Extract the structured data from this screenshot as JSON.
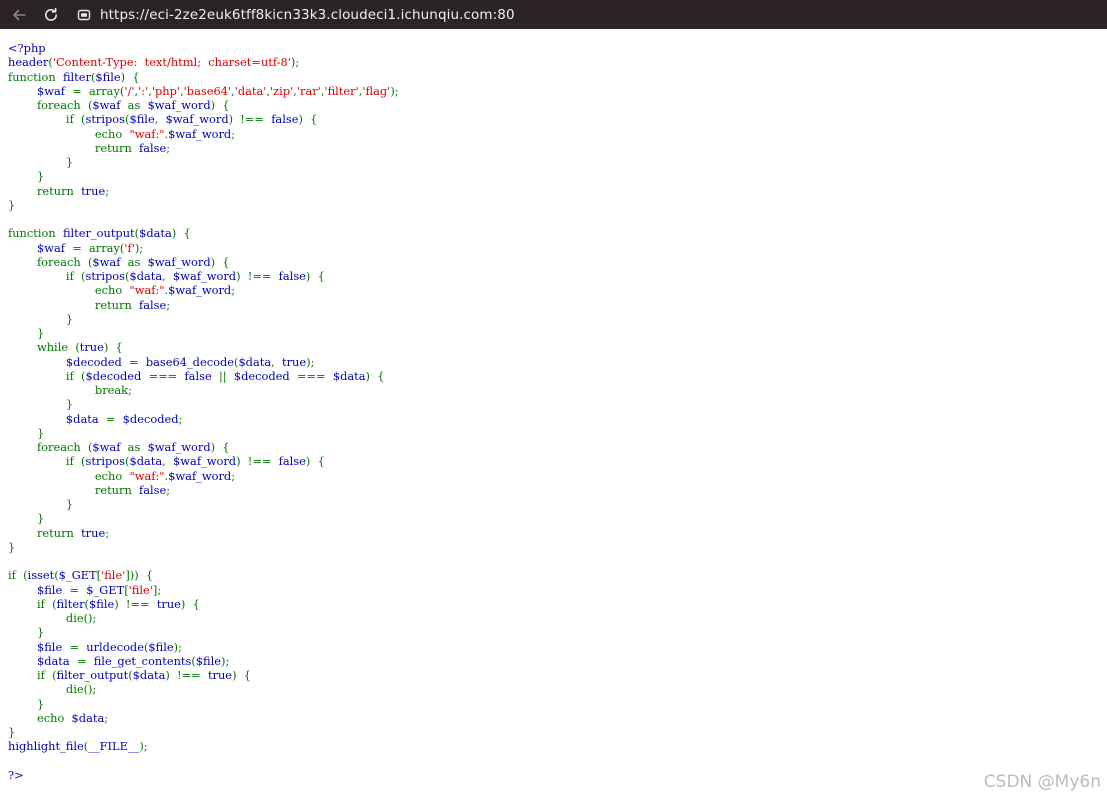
{
  "browser": {
    "url": "https://eci-2ze2euk6tff8kicn33k3.cloudeci1.ichunqiu.com:80",
    "icons": [
      "back-arrow-icon",
      "reload-icon",
      "site-info-icon"
    ]
  },
  "colors": {
    "default": "#0000BB",
    "keyword": "#007700",
    "string": "#DD0000",
    "topbar": "#2b2326"
  },
  "code_lines": [
    [
      [
        "d",
        "<?php"
      ]
    ],
    [
      [
        "d",
        "header"
      ],
      [
        "k",
        "("
      ],
      [
        "s",
        "'Content-Type:  text/html;  charset=utf-8'"
      ],
      [
        "k",
        ");"
      ]
    ],
    [
      [
        "k",
        "function  "
      ],
      [
        "d",
        "filter"
      ],
      [
        "k",
        "("
      ],
      [
        "d",
        "$file"
      ],
      [
        "k",
        ")  {"
      ]
    ],
    [
      [
        "d",
        "        $waf  "
      ],
      [
        "k",
        "=  array("
      ],
      [
        "s",
        "'/'"
      ],
      [
        "k",
        ","
      ],
      [
        "s",
        "':'"
      ],
      [
        "k",
        ","
      ],
      [
        "s",
        "'php'"
      ],
      [
        "k",
        ","
      ],
      [
        "s",
        "'base64'"
      ],
      [
        "k",
        ","
      ],
      [
        "s",
        "'data'"
      ],
      [
        "k",
        ","
      ],
      [
        "s",
        "'zip'"
      ],
      [
        "k",
        ","
      ],
      [
        "s",
        "'rar'"
      ],
      [
        "k",
        ","
      ],
      [
        "s",
        "'filter'"
      ],
      [
        "k",
        ","
      ],
      [
        "s",
        "'flag'"
      ],
      [
        "k",
        ");"
      ]
    ],
    [
      [
        "k",
        "        foreach  ("
      ],
      [
        "d",
        "$waf  "
      ],
      [
        "k",
        "as  "
      ],
      [
        "d",
        "$waf_word"
      ],
      [
        "k",
        ")  {"
      ]
    ],
    [
      [
        "k",
        "                if  ("
      ],
      [
        "d",
        "stripos"
      ],
      [
        "k",
        "("
      ],
      [
        "d",
        "$file"
      ],
      [
        "k",
        ",  "
      ],
      [
        "d",
        "$waf_word"
      ],
      [
        "k",
        ")  !==  "
      ],
      [
        "d",
        "false"
      ],
      [
        "k",
        ")  {"
      ]
    ],
    [
      [
        "k",
        "                        echo  "
      ],
      [
        "s",
        "\"waf:\""
      ],
      [
        "k",
        "."
      ],
      [
        "d",
        "$waf_word"
      ],
      [
        "k",
        ";"
      ]
    ],
    [
      [
        "k",
        "                        return  "
      ],
      [
        "d",
        "false"
      ],
      [
        "k",
        ";"
      ]
    ],
    [
      [
        "k",
        "                }"
      ]
    ],
    [
      [
        "k",
        "        }"
      ]
    ],
    [
      [
        "k",
        "        return  "
      ],
      [
        "d",
        "true"
      ],
      [
        "k",
        ";"
      ]
    ],
    [
      [
        "k",
        "}"
      ]
    ],
    [],
    [
      [
        "k",
        "function  "
      ],
      [
        "d",
        "filter_output"
      ],
      [
        "k",
        "("
      ],
      [
        "d",
        "$data"
      ],
      [
        "k",
        ")  {"
      ]
    ],
    [
      [
        "d",
        "        $waf  "
      ],
      [
        "k",
        "=  array("
      ],
      [
        "s",
        "'f'"
      ],
      [
        "k",
        ");"
      ]
    ],
    [
      [
        "k",
        "        foreach  ("
      ],
      [
        "d",
        "$waf  "
      ],
      [
        "k",
        "as  "
      ],
      [
        "d",
        "$waf_word"
      ],
      [
        "k",
        ")  {"
      ]
    ],
    [
      [
        "k",
        "                if  ("
      ],
      [
        "d",
        "stripos"
      ],
      [
        "k",
        "("
      ],
      [
        "d",
        "$data"
      ],
      [
        "k",
        ",  "
      ],
      [
        "d",
        "$waf_word"
      ],
      [
        "k",
        ")  !==  "
      ],
      [
        "d",
        "false"
      ],
      [
        "k",
        ")  {"
      ]
    ],
    [
      [
        "k",
        "                        echo  "
      ],
      [
        "s",
        "\"waf:\""
      ],
      [
        "k",
        "."
      ],
      [
        "d",
        "$waf_word"
      ],
      [
        "k",
        ";"
      ]
    ],
    [
      [
        "k",
        "                        return  "
      ],
      [
        "d",
        "false"
      ],
      [
        "k",
        ";"
      ]
    ],
    [
      [
        "k",
        "                }"
      ]
    ],
    [
      [
        "k",
        "        }"
      ]
    ],
    [
      [
        "k",
        "        while  ("
      ],
      [
        "d",
        "true"
      ],
      [
        "k",
        ")  {"
      ]
    ],
    [
      [
        "d",
        "                $decoded  "
      ],
      [
        "k",
        "=  "
      ],
      [
        "d",
        "base64_decode"
      ],
      [
        "k",
        "("
      ],
      [
        "d",
        "$data"
      ],
      [
        "k",
        ",  "
      ],
      [
        "d",
        "true"
      ],
      [
        "k",
        ");"
      ]
    ],
    [
      [
        "k",
        "                if  ("
      ],
      [
        "d",
        "$decoded  "
      ],
      [
        "k",
        "===  "
      ],
      [
        "d",
        "false  "
      ],
      [
        "k",
        "||  "
      ],
      [
        "d",
        "$decoded  "
      ],
      [
        "k",
        "===  "
      ],
      [
        "d",
        "$data"
      ],
      [
        "k",
        ")  {"
      ]
    ],
    [
      [
        "k",
        "                        break;"
      ]
    ],
    [
      [
        "k",
        "                }"
      ]
    ],
    [
      [
        "d",
        "                $data  "
      ],
      [
        "k",
        "=  "
      ],
      [
        "d",
        "$decoded"
      ],
      [
        "k",
        ";"
      ]
    ],
    [
      [
        "k",
        "        }"
      ]
    ],
    [
      [
        "k",
        "        foreach  ("
      ],
      [
        "d",
        "$waf  "
      ],
      [
        "k",
        "as  "
      ],
      [
        "d",
        "$waf_word"
      ],
      [
        "k",
        ")  {"
      ]
    ],
    [
      [
        "k",
        "                if  ("
      ],
      [
        "d",
        "stripos"
      ],
      [
        "k",
        "("
      ],
      [
        "d",
        "$data"
      ],
      [
        "k",
        ",  "
      ],
      [
        "d",
        "$waf_word"
      ],
      [
        "k",
        ")  !==  "
      ],
      [
        "d",
        "false"
      ],
      [
        "k",
        ")  {"
      ]
    ],
    [
      [
        "k",
        "                        echo  "
      ],
      [
        "s",
        "\"waf:\""
      ],
      [
        "k",
        "."
      ],
      [
        "d",
        "$waf_word"
      ],
      [
        "k",
        ";"
      ]
    ],
    [
      [
        "k",
        "                        return  "
      ],
      [
        "d",
        "false"
      ],
      [
        "k",
        ";"
      ]
    ],
    [
      [
        "k",
        "                }"
      ]
    ],
    [
      [
        "k",
        "        }"
      ]
    ],
    [
      [
        "k",
        "        return  "
      ],
      [
        "d",
        "true"
      ],
      [
        "k",
        ";"
      ]
    ],
    [
      [
        "k",
        "}"
      ]
    ],
    [],
    [
      [
        "k",
        "if  ("
      ],
      [
        "d",
        "isset"
      ],
      [
        "k",
        "("
      ],
      [
        "d",
        "$_GET"
      ],
      [
        "k",
        "["
      ],
      [
        "s",
        "'file'"
      ],
      [
        "k",
        "]))  {"
      ]
    ],
    [
      [
        "d",
        "        $file  "
      ],
      [
        "k",
        "=  "
      ],
      [
        "d",
        "$_GET"
      ],
      [
        "k",
        "["
      ],
      [
        "s",
        "'file'"
      ],
      [
        "k",
        "];"
      ]
    ],
    [
      [
        "k",
        "        if  ("
      ],
      [
        "d",
        "filter"
      ],
      [
        "k",
        "("
      ],
      [
        "d",
        "$file"
      ],
      [
        "k",
        ")  !==  "
      ],
      [
        "d",
        "true"
      ],
      [
        "k",
        ")  {"
      ]
    ],
    [
      [
        "k",
        "                die();"
      ]
    ],
    [
      [
        "k",
        "        }"
      ]
    ],
    [
      [
        "d",
        "        $file  "
      ],
      [
        "k",
        "=  "
      ],
      [
        "d",
        "urldecode"
      ],
      [
        "k",
        "("
      ],
      [
        "d",
        "$file"
      ],
      [
        "k",
        ");"
      ]
    ],
    [
      [
        "d",
        "        $data  "
      ],
      [
        "k",
        "=  "
      ],
      [
        "d",
        "file_get_contents"
      ],
      [
        "k",
        "("
      ],
      [
        "d",
        "$file"
      ],
      [
        "k",
        ");"
      ]
    ],
    [
      [
        "k",
        "        if  ("
      ],
      [
        "d",
        "filter_output"
      ],
      [
        "k",
        "("
      ],
      [
        "d",
        "$data"
      ],
      [
        "k",
        ")  !==  "
      ],
      [
        "d",
        "true"
      ],
      [
        "k",
        ")  {"
      ]
    ],
    [
      [
        "k",
        "                die();"
      ]
    ],
    [
      [
        "k",
        "        }"
      ]
    ],
    [
      [
        "k",
        "        echo  "
      ],
      [
        "d",
        "$data"
      ],
      [
        "k",
        ";"
      ]
    ],
    [
      [
        "k",
        "}"
      ]
    ],
    [
      [
        "d",
        "highlight_file"
      ],
      [
        "k",
        "("
      ],
      [
        "d",
        "__FILE__"
      ],
      [
        "k",
        ");"
      ]
    ],
    [],
    [
      [
        "d",
        "?>"
      ]
    ]
  ],
  "watermark": "CSDN @My6n"
}
